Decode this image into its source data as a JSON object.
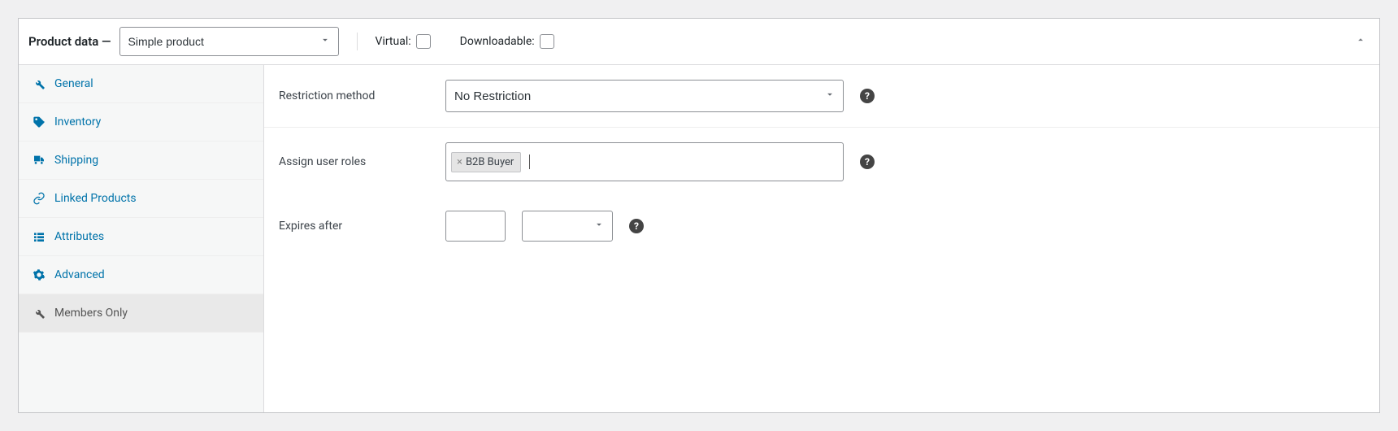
{
  "header": {
    "title": "Product data —",
    "product_type": "Simple product",
    "virtual_label": "Virtual:",
    "downloadable_label": "Downloadable:"
  },
  "tabs": [
    {
      "id": "general",
      "label": "General",
      "icon": "wrench"
    },
    {
      "id": "inventory",
      "label": "Inventory",
      "icon": "tag"
    },
    {
      "id": "shipping",
      "label": "Shipping",
      "icon": "truck"
    },
    {
      "id": "linked",
      "label": "Linked Products",
      "icon": "link"
    },
    {
      "id": "attributes",
      "label": "Attributes",
      "icon": "list"
    },
    {
      "id": "advanced",
      "label": "Advanced",
      "icon": "gear"
    },
    {
      "id": "members",
      "label": "Members Only",
      "icon": "wrench",
      "active": true
    }
  ],
  "form": {
    "restriction_label": "Restriction method",
    "restriction_value": "No Restriction",
    "assign_label": "Assign user roles",
    "assign_chip": "B2B Buyer",
    "expires_label": "Expires after",
    "expires_value": "",
    "expires_unit": ""
  }
}
